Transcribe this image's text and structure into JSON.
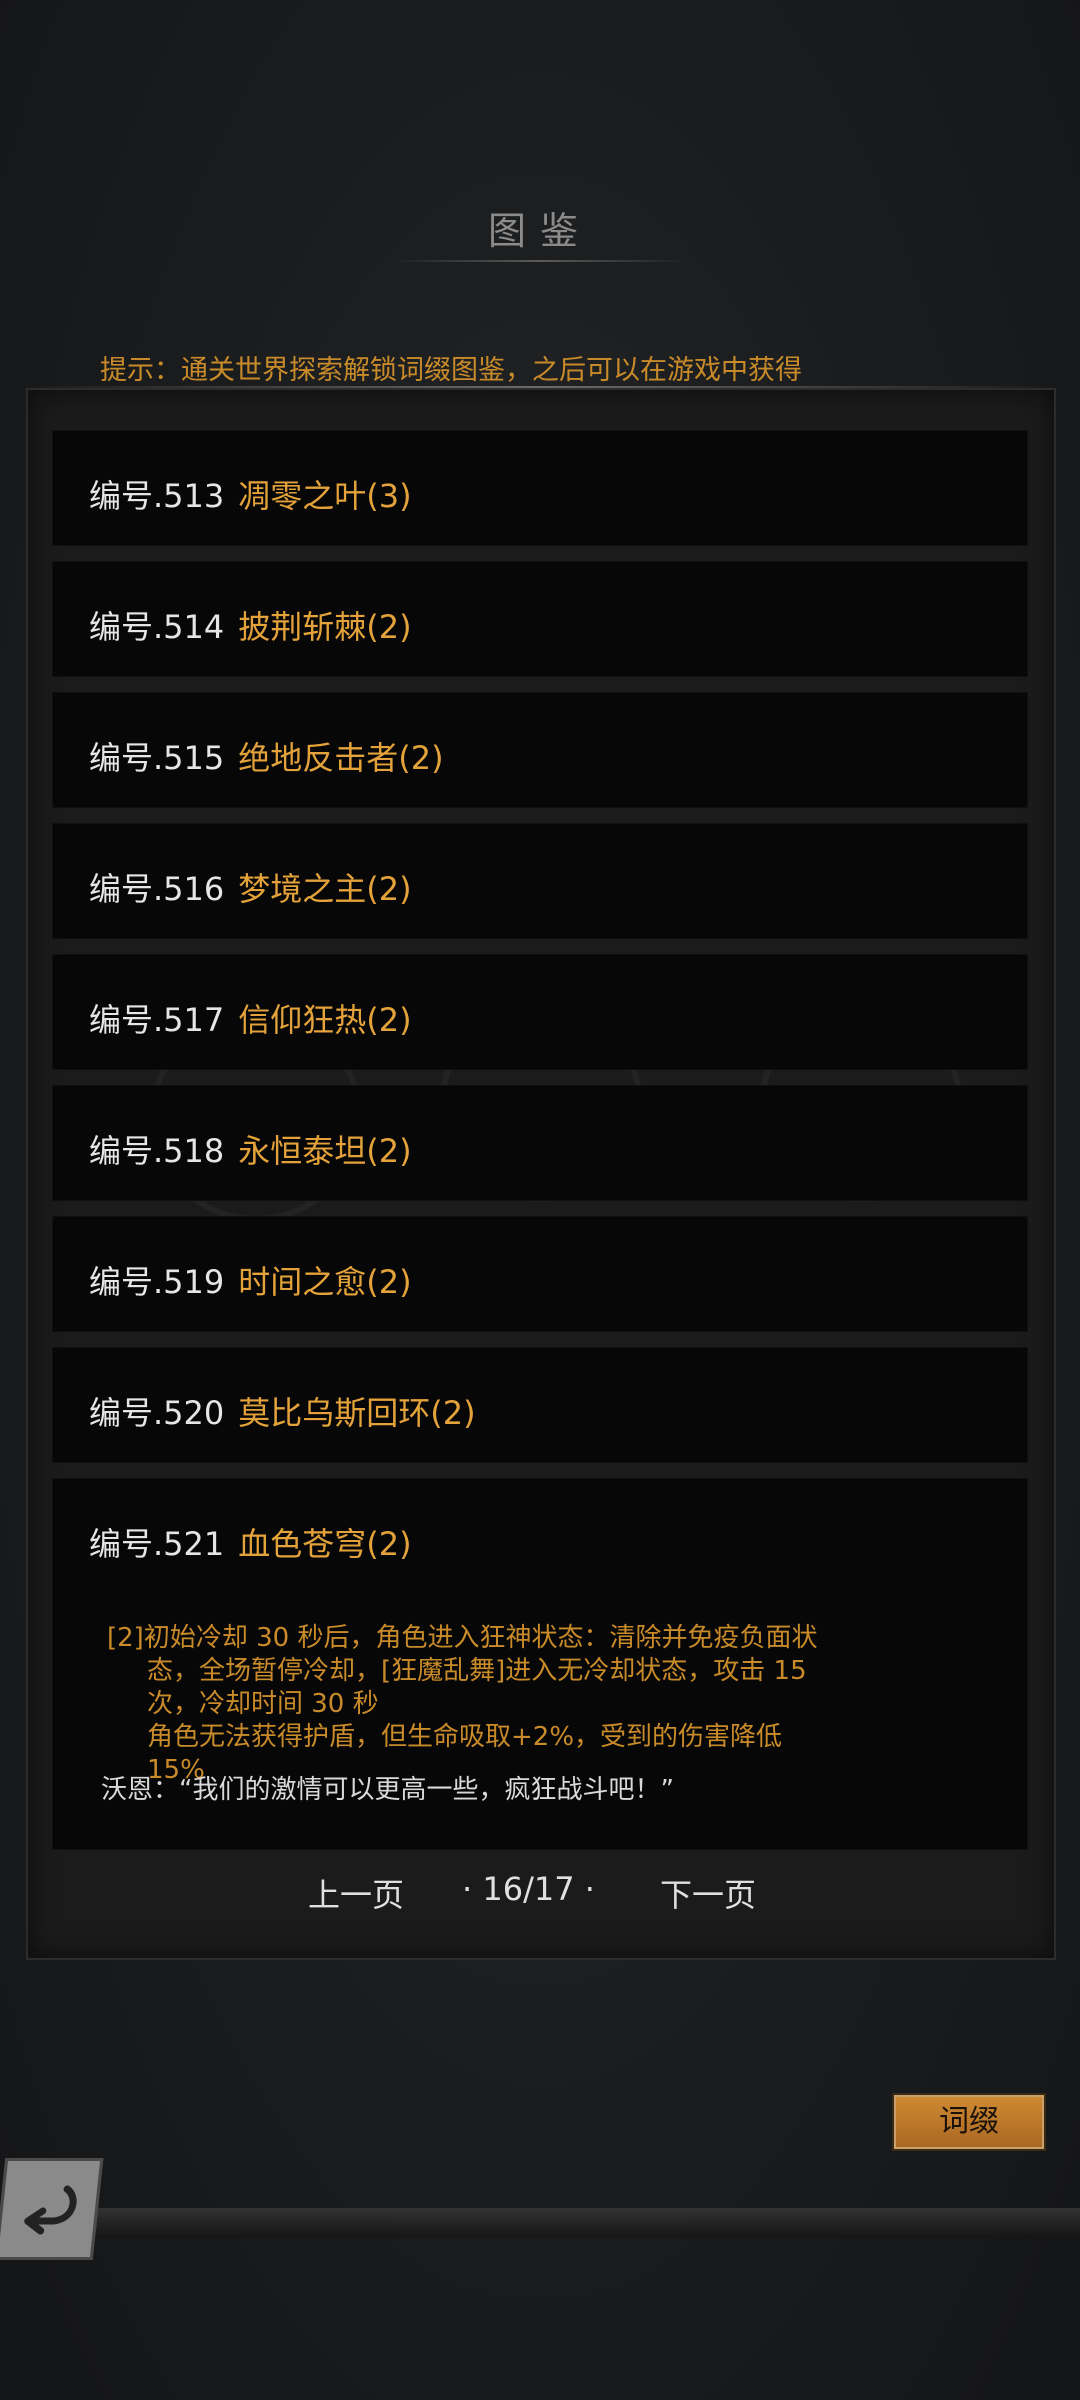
{
  "header": {
    "title": "图鉴",
    "hint": "提示：通关世界探索解锁词缀图鉴，之后可以在游戏中获得"
  },
  "entries": [
    {
      "number": "编号.513",
      "name": "凋零之叶(3)"
    },
    {
      "number": "编号.514",
      "name": "披荆斩棘(2)"
    },
    {
      "number": "编号.515",
      "name": "绝地反击者(2)"
    },
    {
      "number": "编号.516",
      "name": "梦境之主(2)"
    },
    {
      "number": "编号.517",
      "name": "信仰狂热(2)"
    },
    {
      "number": "编号.518",
      "name": "永恒泰坦(2)"
    },
    {
      "number": "编号.519",
      "name": "时间之愈(2)"
    },
    {
      "number": "编号.520",
      "name": "莫比乌斯回环(2)"
    },
    {
      "number": "编号.521",
      "name": "血色苍穹(2)"
    }
  ],
  "expanded_entry": {
    "line1": "[2]初始冷却 30 秒后，角色进入狂神状态：清除并免疫负面状",
    "line2": "态，全场暂停冷却，[狂魔乱舞]进入无冷却状态，攻击 15",
    "line3": "次，冷却时间 30 秒",
    "line4": "角色无法获得护盾，但生命吸取+2%，受到的伤害降低",
    "line5": "15%",
    "quote": "沃恩：“我们的激情可以更高一些，疯狂战斗吧！”"
  },
  "pager": {
    "prev": "上一页",
    "page": "· 16/17 ·",
    "next": "下一页"
  },
  "buttons": {
    "affix": "词缀"
  },
  "icons": {
    "back": "back-arrow-icon"
  },
  "colors": {
    "accent": "#e3a23a",
    "hint": "#c98b2a"
  }
}
